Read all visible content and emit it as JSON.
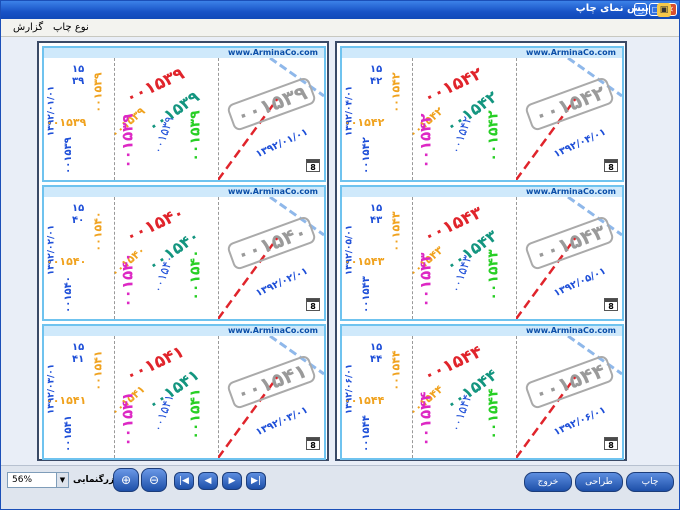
{
  "window": {
    "title": "پیش نمای چاپ"
  },
  "menu": {
    "items": [
      "گزارش",
      "نوع چاپ"
    ]
  },
  "site": "www.ArminaCo.com",
  "calendar_day": "8",
  "tickets": [
    {
      "big": "۰۰۱۵۳۹",
      "date": "۱۳۹۲/۰۱/۰۱",
      "s1": "۱۵",
      "s2": "۳۹"
    },
    {
      "big": "۰۰۱۵۴۰",
      "date": "۱۳۹۲/۰۲/۰۱",
      "s1": "۱۵",
      "s2": "۴۰"
    },
    {
      "big": "۰۰۱۵۴۱",
      "date": "۱۳۹۲/۰۳/۰۱",
      "s1": "۱۵",
      "s2": "۴۱"
    },
    {
      "big": "۰۰۱۵۴۲",
      "date": "۱۳۹۲/۰۴/۰۱",
      "s1": "۱۵",
      "s2": "۴۲"
    },
    {
      "big": "۰۰۱۵۴۳",
      "date": "۱۳۹۲/۰۵/۰۱",
      "s1": "۱۵",
      "s2": "۴۳"
    },
    {
      "big": "۰۰۱۵۴۴",
      "date": "۱۳۹۲/۰۶/۰۱",
      "s1": "۱۵",
      "s2": "۴۴"
    }
  ],
  "toolbar": {
    "zoom_value": "56%",
    "zoom_label": "بزرگنمایی",
    "exit": "خروج",
    "design": "طراحی",
    "print": "چاپ"
  },
  "colors": {
    "red": "#e0242b",
    "teal": "#13957f",
    "magenta": "#dd28c4",
    "blue": "#1e4fd8",
    "green": "#27cf24",
    "orange": "#f0a21e"
  }
}
